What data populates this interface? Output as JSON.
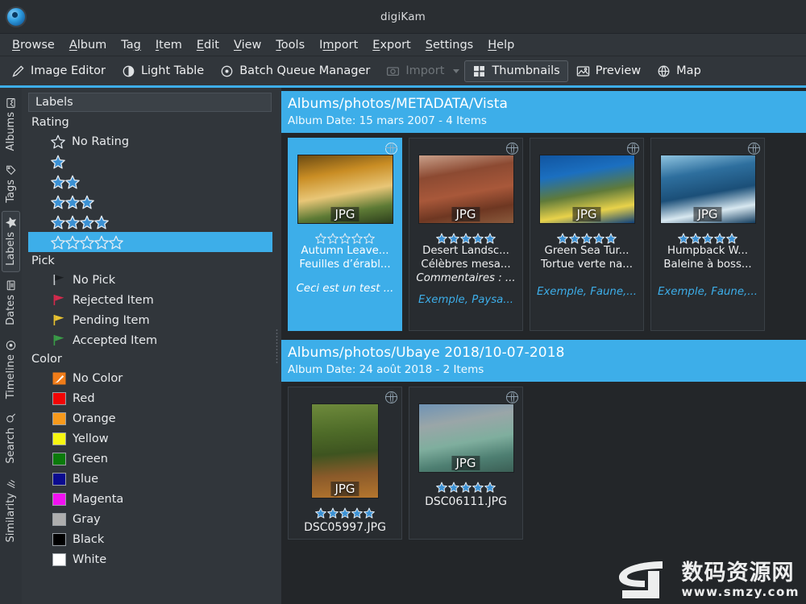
{
  "window": {
    "title": "digiKam",
    "logo_icon": "digikam-logo-icon"
  },
  "menubar": {
    "items": [
      {
        "label": "Browse",
        "accel": "B"
      },
      {
        "label": "Album",
        "accel": "A"
      },
      {
        "label": "Tag",
        "accel": "g"
      },
      {
        "label": "Item",
        "accel": "I"
      },
      {
        "label": "Edit",
        "accel": "E"
      },
      {
        "label": "View",
        "accel": "V"
      },
      {
        "label": "Tools",
        "accel": "T"
      },
      {
        "label": "Import",
        "accel": "m"
      },
      {
        "label": "Export",
        "accel": "E"
      },
      {
        "label": "Settings",
        "accel": "S"
      },
      {
        "label": "Help",
        "accel": "H"
      }
    ]
  },
  "toolbar": {
    "buttons": [
      {
        "label": "Image Editor",
        "icon": "pencil-icon",
        "state": "normal"
      },
      {
        "label": "Light Table",
        "icon": "light-table-icon",
        "state": "normal"
      },
      {
        "label": "Batch Queue Manager",
        "icon": "batch-queue-icon",
        "state": "normal"
      },
      {
        "label": "Import",
        "icon": "import-camera-icon",
        "state": "disabled",
        "has_dropdown": true
      },
      {
        "label": "Thumbnails",
        "icon": "thumbnails-grid-icon",
        "state": "active"
      },
      {
        "label": "Preview",
        "icon": "preview-image-icon",
        "state": "normal"
      },
      {
        "label": "Map",
        "icon": "globe-map-icon",
        "state": "normal"
      }
    ]
  },
  "sidebar_tabs": {
    "items": [
      {
        "label": "Albums",
        "icon": "albums-icon",
        "selected": false
      },
      {
        "label": "Tags",
        "icon": "tag-icon",
        "selected": false
      },
      {
        "label": "Labels",
        "icon": "star-icon",
        "selected": true
      },
      {
        "label": "Dates",
        "icon": "calendar-icon",
        "selected": false
      },
      {
        "label": "Timeline",
        "icon": "timeline-clock-icon",
        "selected": false
      },
      {
        "label": "Search",
        "icon": "search-magnifier-icon",
        "selected": false
      },
      {
        "label": "Similarity",
        "icon": "similarity-icon",
        "selected": false
      }
    ]
  },
  "labels_panel": {
    "header": "Labels",
    "rating": {
      "group_label": "Rating",
      "rows": [
        {
          "label": "No Rating",
          "stars": 0,
          "outline_only": true,
          "selected": false
        },
        {
          "label": "",
          "stars": 1,
          "outline_only": false,
          "selected": false
        },
        {
          "label": "",
          "stars": 2,
          "outline_only": false,
          "selected": false
        },
        {
          "label": "",
          "stars": 3,
          "outline_only": false,
          "selected": false
        },
        {
          "label": "",
          "stars": 4,
          "outline_only": false,
          "selected": false
        },
        {
          "label": "",
          "stars": 5,
          "outline_only": true,
          "selected": true
        }
      ]
    },
    "pick": {
      "group_label": "Pick",
      "rows": [
        {
          "label": "No Pick",
          "flag_color": "#1b1e21",
          "icon": "flag-nopick-icon"
        },
        {
          "label": "Rejected Item",
          "flag_color": "#d42a4c",
          "icon": "flag-rejected-icon"
        },
        {
          "label": "Pending Item",
          "flag_color": "#e8c230",
          "icon": "flag-pending-icon"
        },
        {
          "label": "Accepted Item",
          "flag_color": "#3a9b47",
          "icon": "flag-accepted-icon"
        }
      ]
    },
    "color": {
      "group_label": "Color",
      "rows": [
        {
          "label": "No Color",
          "swatch": "#f07c19",
          "icon": "no-color-brush-icon"
        },
        {
          "label": "Red",
          "swatch": "#f20505"
        },
        {
          "label": "Orange",
          "swatch": "#f79a1c"
        },
        {
          "label": "Yellow",
          "swatch": "#f7f711"
        },
        {
          "label": "Green",
          "swatch": "#0b7a0b"
        },
        {
          "label": "Blue",
          "swatch": "#0b0b8f"
        },
        {
          "label": "Magenta",
          "swatch": "#f211f2"
        },
        {
          "label": "Gray",
          "swatch": "#aeaeae"
        },
        {
          "label": "Black",
          "swatch": "#000000"
        },
        {
          "label": "White",
          "swatch": "#ffffff"
        }
      ]
    }
  },
  "colors": {
    "accent": "#3daee9",
    "window_bg": "#31363b",
    "view_bg": "#232629",
    "text": "#eff0f1"
  },
  "content": {
    "albums": [
      {
        "title": "Albums/photos/METADATA/Vista",
        "subtitle": "Album Date: 15 mars 2007 - 4 Items",
        "items": [
          {
            "selected": true,
            "orientation": "landscape",
            "format_badge": "JPG",
            "geo_icon": "globe-icon",
            "stars": 5,
            "stars_filled": false,
            "lines": [
              {
                "text": "Autumn Leave...",
                "style": "normal"
              },
              {
                "text": "Feuilles d’érabl...",
                "style": "normal"
              },
              {
                "text": "Ceci est un test ...",
                "style": "italic-spaced"
              }
            ],
            "thumb_colors": [
              "#6b4a12",
              "#c98d24",
              "#e8c677",
              "#5d7a35",
              "#2d3f1c"
            ]
          },
          {
            "selected": false,
            "orientation": "landscape",
            "format_badge": "JPG",
            "geo_icon": "globe-icon",
            "stars": 5,
            "stars_filled": true,
            "lines": [
              {
                "text": "Desert Landsc...",
                "style": "normal"
              },
              {
                "text": "Célèbres mesa...",
                "style": "normal"
              },
              {
                "text": "Commentaires : ...",
                "style": "italic"
              },
              {
                "text": "Exemple, Paysa...",
                "style": "tags"
              }
            ],
            "thumb_colors": [
              "#c9a08a",
              "#8c4a32",
              "#a8583a",
              "#6e3722",
              "#8a5a3c"
            ]
          },
          {
            "selected": false,
            "orientation": "landscape",
            "format_badge": "JPG",
            "geo_icon": "globe-icon",
            "stars": 5,
            "stars_filled": true,
            "lines": [
              {
                "text": "Green Sea Tur...",
                "style": "normal"
              },
              {
                "text": "Tortue verte na...",
                "style": "normal"
              },
              {
                "text": "Exemple, Faune,...",
                "style": "tags-spaced"
              }
            ],
            "thumb_colors": [
              "#1155a0",
              "#1b6fc0",
              "#5f7a3a",
              "#e8d24a",
              "#0d3f7a"
            ]
          },
          {
            "selected": false,
            "orientation": "landscape",
            "format_badge": "JPG",
            "geo_icon": "globe-icon",
            "stars": 5,
            "stars_filled": true,
            "lines": [
              {
                "text": "Humpback W...",
                "style": "normal"
              },
              {
                "text": "Baleine à boss...",
                "style": "normal"
              },
              {
                "text": "Exemple, Faune,...",
                "style": "tags-spaced"
              }
            ],
            "thumb_colors": [
              "#8fc4e0",
              "#2e6f9e",
              "#1b4f78",
              "#d8e8f0",
              "#123c5e"
            ]
          }
        ]
      },
      {
        "title": "Albums/photos/Ubaye 2018/10-07-2018",
        "subtitle": "Album Date: 24 août 2018 - 2 Items",
        "items": [
          {
            "selected": false,
            "orientation": "portrait",
            "format_badge": "JPG",
            "geo_icon": "globe-icon",
            "stars": 5,
            "stars_filled": true,
            "lines": [
              {
                "text": "DSC05997.JPG",
                "style": "filename"
              }
            ],
            "thumb_colors": [
              "#6e8a3c",
              "#4e6b28",
              "#8a5a2a",
              "#b5762e",
              "#3e5420"
            ]
          },
          {
            "selected": false,
            "orientation": "landscape",
            "format_badge": "JPG",
            "geo_icon": "globe-icon",
            "stars": 5,
            "stars_filled": true,
            "lines": [
              {
                "text": "DSC06111.JPG",
                "style": "filename"
              }
            ],
            "thumb_colors": [
              "#6f93b5",
              "#9aa6a8",
              "#7fae9e",
              "#4e7f72",
              "#3b5f55"
            ]
          }
        ]
      }
    ]
  },
  "watermark": {
    "cn": "数码资源网",
    "url": "www.smzy.com"
  }
}
